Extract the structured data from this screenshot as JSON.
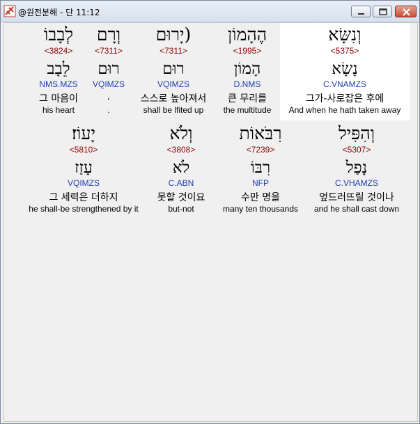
{
  "window": {
    "title": "@원전분해 - 단 11:12"
  },
  "colors": {
    "strong": "#8b0000",
    "parse": "#1f3fb0",
    "highlight": "#ffffff"
  },
  "rows": [
    {
      "words": [
        {
          "hebrew": "וְנִשָּׂא",
          "strong": "<5375>",
          "root": "נָשָׂא",
          "parse": "C.VNAMZS",
          "korean": "그가-사로잡은 후에",
          "english": "And when he hath taken away",
          "highlighted": true
        },
        {
          "hebrew": "הֶהָמוֹן",
          "strong": "<1995>",
          "root": "הָמוֹן",
          "parse": "D.NMS",
          "korean": "큰 무리를",
          "english": "the multitude",
          "highlighted": false
        },
        {
          "hebrew": "(יָרוּם",
          "strong": "<7311>",
          "root": "רוּם",
          "parse": "VQIMZS",
          "korean": "스스로 높아져서",
          "english": "shall be lfited up",
          "highlighted": false
        },
        {
          "hebrew": "וְרָם",
          "strong": "<7311>",
          "root": "רוּם",
          "parse": "VQIMZS",
          "korean": ".",
          "english": ".",
          "highlighted": false
        },
        {
          "hebrew": "לְבָבוֹ",
          "strong": "<3824>",
          "root": "לֵבָב",
          "parse": "NMS.MZS",
          "korean": "그 마음이",
          "english": "his heart",
          "highlighted": false
        }
      ]
    },
    {
      "words": [
        {
          "hebrew": "וְהִפִּיל",
          "strong": "<5307>",
          "root": "נָפַל",
          "parse": "C.VHAMZS",
          "korean": "엎드러뜨릴 것이나",
          "english": "and he shall cast down",
          "highlighted": false
        },
        {
          "hebrew": "רִבֹּאוֹת",
          "strong": "<7239>",
          "root": "רִבּוֹ",
          "parse": "NFP",
          "korean": "수만 명을",
          "english": "many ten thousands",
          "highlighted": false
        },
        {
          "hebrew": "וְלֹא",
          "strong": "<3808>",
          "root": "לֹא",
          "parse": "C.ABN",
          "korean": "못할 것이요",
          "english": "but-not",
          "highlighted": false
        },
        {
          "hebrew": "יָעוֹז׃",
          "strong": "<5810>",
          "root": "עָזַז",
          "parse": "VQIMZS",
          "korean": "그 세력은 더하지",
          "english": "he shall-be strengthened by it",
          "highlighted": false
        }
      ]
    }
  ]
}
